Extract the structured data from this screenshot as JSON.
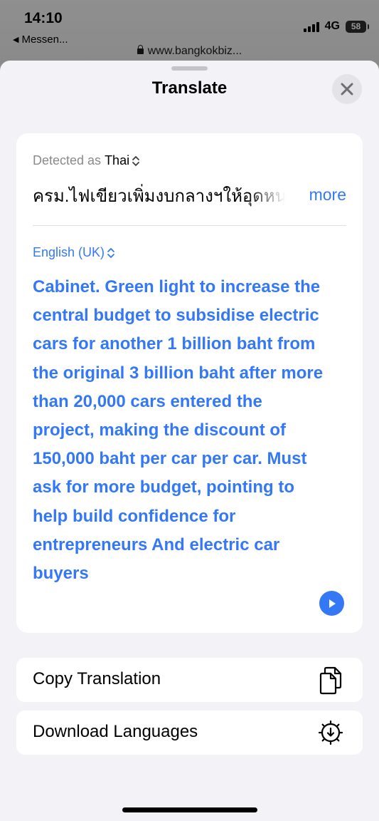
{
  "status_bar": {
    "time": "14:10",
    "back_app": "Messen...",
    "network": "4G",
    "battery": "58",
    "url": "www.bangkokbiz..."
  },
  "sheet": {
    "title": "Translate"
  },
  "translation_card": {
    "detected_prefix": "Detected as",
    "detected_language": "Thai",
    "source_text": "ครม.ไฟเขียวเพิ่มงบกลางฯให้อุดหนุนรถยนต์ไฟฟ้า",
    "more_label": "more",
    "target_language": "English (UK)",
    "translation_text": "Cabinet. Green light to increase the central budget to subsidise electric cars for another 1 billion baht from the original 3 billion baht after more than 20,000 cars entered the project, making the discount of 150,000 baht per car per car. Must ask for more budget, pointing to help build confidence for entrepreneurs And electric car buyers"
  },
  "actions": {
    "copy_label": "Copy Translation",
    "download_label": "Download Languages"
  },
  "colors": {
    "accent": "#3478f6",
    "sheet_background": "#f2f2f7",
    "card_background": "#ffffff",
    "secondary_text": "#8a8a8e"
  },
  "icons": {
    "close": "close-icon",
    "play": "play-icon",
    "copy": "copy-documents-icon",
    "download": "gear-download-icon"
  }
}
